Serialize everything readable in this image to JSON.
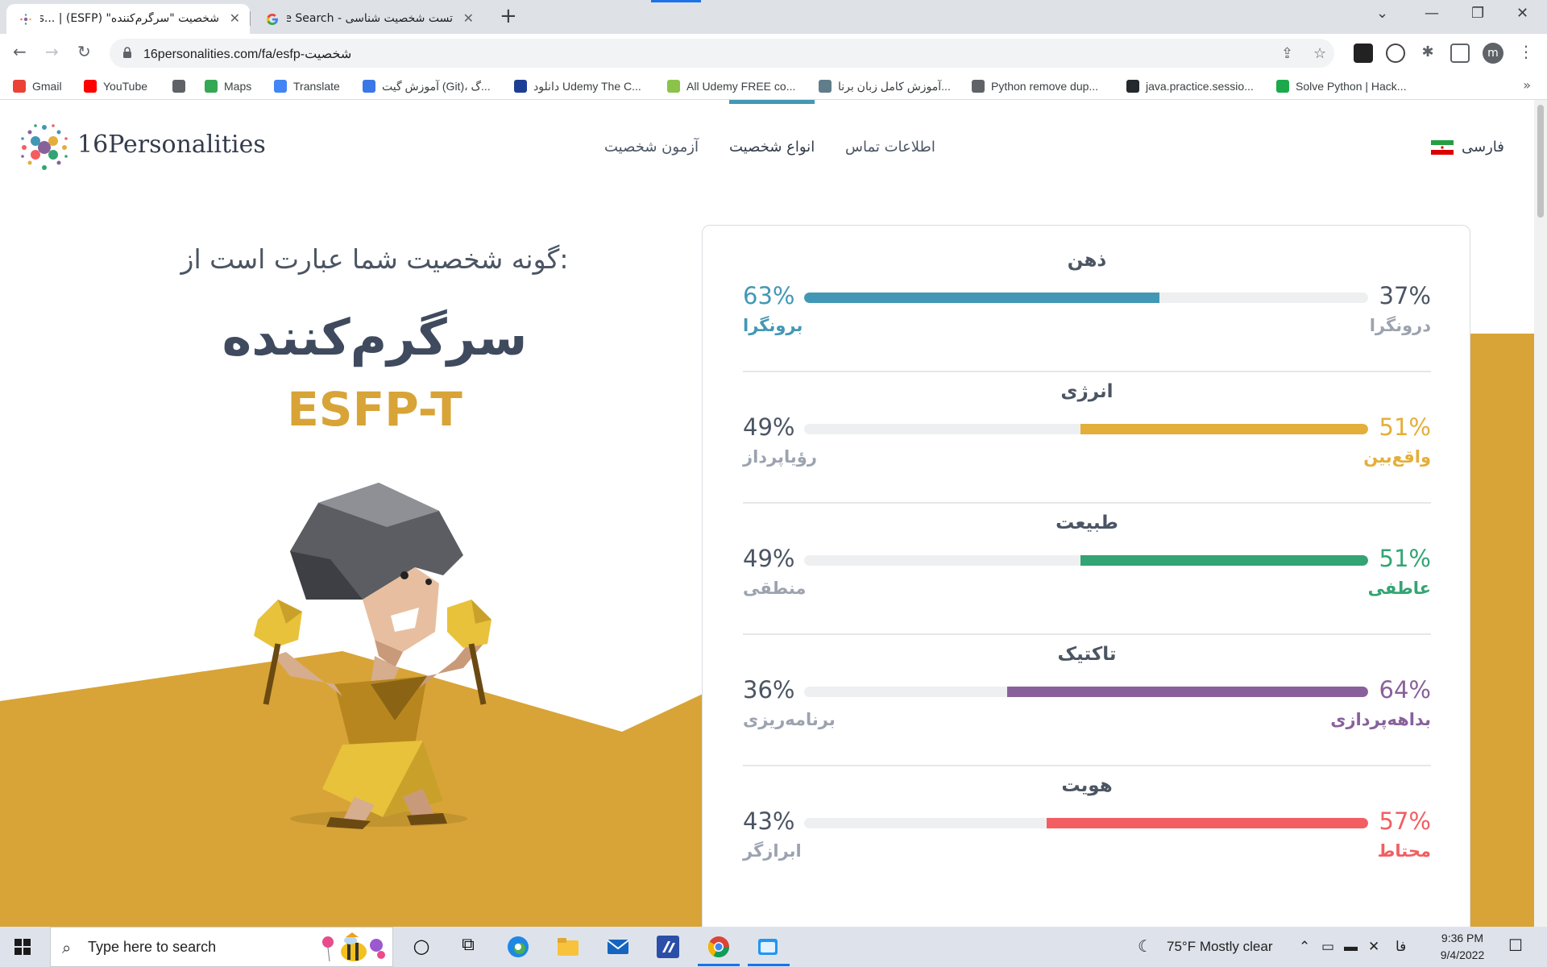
{
  "browser": {
    "tabs": [
      {
        "title": "شخصیت \"سرگرم‌کننده\" (ESFP) | ...ies",
        "active": true
      },
      {
        "title": "تست شخصیت شناسی - Google Search",
        "active": false
      }
    ],
    "url": "16personalities.com/fa/esfp-شخصیت",
    "bookmarks": [
      {
        "label": "Gmail",
        "icon": "gmail-icon",
        "color": "#ea4335"
      },
      {
        "label": "YouTube",
        "icon": "youtube-icon",
        "color": "#ff0000"
      },
      {
        "label": "",
        "icon": "globe-icon",
        "color": "#5f6368"
      },
      {
        "label": "Maps",
        "icon": "maps-icon",
        "color": "#34a853"
      },
      {
        "label": "Translate",
        "icon": "translate-icon",
        "color": "#4285f4"
      },
      {
        "label": "آموزش گیت (Git)، گ...",
        "icon": "image-icon",
        "color": "#3b78e7"
      },
      {
        "label": "دانلود Udemy The C...",
        "icon": "udemy-icon",
        "color": "#1c3f94"
      },
      {
        "label": "All Udemy FREE co...",
        "icon": "udemy-free-icon",
        "color": "#8bc34a"
      },
      {
        "label": "آموزش کامل زبان برنا...",
        "icon": "doc-icon",
        "color": "#607d8b"
      },
      {
        "label": "Python remove dup...",
        "icon": "globe-icon",
        "color": "#5f6368"
      },
      {
        "label": "java.practice.sessio...",
        "icon": "github-icon",
        "color": "#24292e"
      },
      {
        "label": "Solve Python | Hack...",
        "icon": "hackerrank-icon",
        "color": "#1ba94c"
      }
    ],
    "profile_initial": "m"
  },
  "header": {
    "logo_text": "16Personalities",
    "nav": {
      "test": "آزمون شخصیت",
      "types": "انواع شخصیت",
      "contact": "اطلاعات تماس"
    },
    "language": "فارسی"
  },
  "result": {
    "intro": ":گونه شخصیت شما عبارت است از",
    "type_name": "سرگرم‌کننده",
    "type_code": "ESFP-T"
  },
  "traits": [
    {
      "title": "ذهن",
      "left_pct": "63%",
      "left_label": "برونگرا",
      "right_pct": "37%",
      "right_label": "درونگرا",
      "fill_side": "left",
      "value": 0.63,
      "color": "#4298b4",
      "highlight": "left"
    },
    {
      "title": "انرژی",
      "left_pct": "49%",
      "left_label": "رؤیاپرداز",
      "right_pct": "51%",
      "right_label": "واقع‌بین",
      "fill_side": "right",
      "value": 0.51,
      "color": "#e4ae3a",
      "highlight": "right"
    },
    {
      "title": "طبیعت",
      "left_pct": "49%",
      "left_label": "منطقی",
      "right_pct": "51%",
      "right_label": "عاطفی",
      "fill_side": "right",
      "value": 0.51,
      "color": "#33a474",
      "highlight": "right"
    },
    {
      "title": "تاکتیک",
      "left_pct": "36%",
      "left_label": "برنامه‌ریزی",
      "right_pct": "64%",
      "right_label": "بداهه‌پردازی",
      "fill_side": "right",
      "value": 0.64,
      "color": "#88619a",
      "highlight": "right"
    },
    {
      "title": "هویت",
      "left_pct": "43%",
      "left_label": "ابرازگر",
      "right_pct": "57%",
      "right_label": "محتاط",
      "fill_side": "right",
      "value": 0.57,
      "color": "#f25e62",
      "highlight": "right"
    }
  ],
  "taskbar": {
    "search_placeholder": "Type here to search",
    "weather": "75°F  Mostly clear",
    "lang_indicator": "فا",
    "time": "9:36 PM",
    "date": "9/4/2022"
  },
  "colors": {
    "brand_gold": "#d8a437",
    "muted_text": "#9ca3af"
  }
}
